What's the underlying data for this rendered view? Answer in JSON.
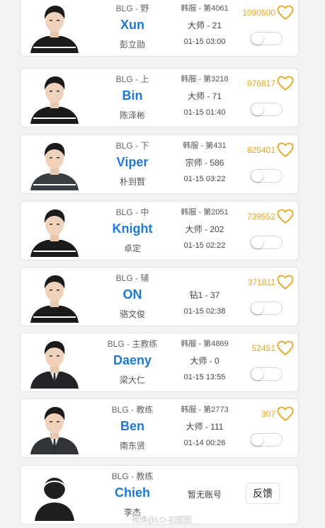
{
  "players": [
    {
      "team": "BLG - 野",
      "ign": "Xun",
      "realname": "彭立勋",
      "server": "韩服 - 第4061",
      "tier": "大师 - 21",
      "time": "01-15 03:00",
      "likes": "1090500",
      "notify_on": false,
      "photo": "player-photo",
      "jersey": "#1a1a1a"
    },
    {
      "team": "BLG - 上",
      "ign": "Bin",
      "realname": "陈泽彬",
      "server": "韩服 - 第3218",
      "tier": "大师 - 71",
      "time": "01-15 01:40",
      "likes": "976817",
      "notify_on": false,
      "photo": "player-photo",
      "jersey": "#1a1a1a"
    },
    {
      "team": "BLG - 下",
      "ign": "Viper",
      "realname": "朴到賢",
      "server": "韩服 - 第431",
      "tier": "宗师 - 586",
      "time": "01-15 03:22",
      "likes": "825401",
      "notify_on": false,
      "photo": "player-photo",
      "jersey": "#3a3d42"
    },
    {
      "team": "BLG - 中",
      "ign": "Knight",
      "realname": "卓定",
      "server": "韩服 - 第2051",
      "tier": "大师 - 202",
      "time": "01-15 02:22",
      "likes": "739552",
      "notify_on": false,
      "photo": "player-photo",
      "jersey": "#1a1a1a"
    },
    {
      "team": "BLG - 辅",
      "ign": "ON",
      "realname": "骆文俊",
      "server": "",
      "tier": "钻1 - 37",
      "time": "01-15 02:38",
      "likes": "371811",
      "notify_on": false,
      "photo": "player-photo",
      "jersey": "#1a1a1a"
    },
    {
      "team": "BLG - 主教练",
      "ign": "Daeny",
      "realname": "梁大仁",
      "server": "韩服 - 第4869",
      "tier": "大师 - 0",
      "time": "01-15 13:55",
      "likes": "52451",
      "notify_on": false,
      "photo": "coach-photo",
      "jersey": "#222428"
    },
    {
      "team": "BLG - 教练",
      "ign": "Ben",
      "realname": "南东贤",
      "server": "韩服 - 第2773",
      "tier": "大师 - 111",
      "time": "01-14 00:26",
      "likes": "307",
      "notify_on": false,
      "photo": "coach-photo",
      "jersey": "#303338"
    }
  ],
  "last_card": {
    "team": "BLG - 教练",
    "ign": "Chieh",
    "realname": "李杰",
    "no_account": "暂无账号",
    "feedback_label": "反馈",
    "photo": "default-avatar-icon"
  },
  "watermark": "微博@LO-初图图",
  "colors": {
    "accent_blue": "#1e78d8",
    "like_gold": "#e8a41c",
    "background": "#f2f2f4",
    "card": "#ffffff"
  },
  "icons": {
    "like": "heart-outline-icon",
    "notify": "toggle-switch"
  }
}
